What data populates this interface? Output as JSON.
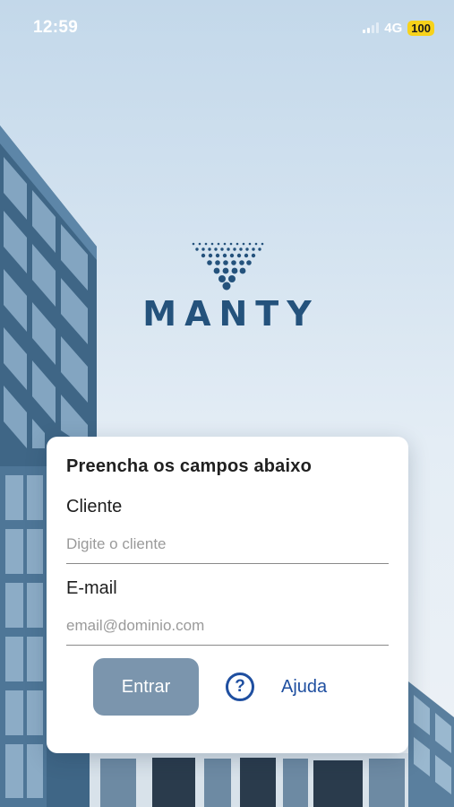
{
  "status_bar": {
    "time": "12:59",
    "network": "4G",
    "battery": "100"
  },
  "logo": {
    "brand": "MANTY",
    "mark_icon": "droplet-dots-icon"
  },
  "login_card": {
    "title": "Preencha os campos abaixo",
    "client": {
      "label": "Cliente",
      "placeholder": "Digite o cliente",
      "value": ""
    },
    "email": {
      "label": "E-mail",
      "placeholder": "email@dominio.com",
      "value": ""
    },
    "enter_label": "Entrar",
    "help_label": "Ajuda",
    "help_icon": "question-circle-icon"
  },
  "colors": {
    "brand": "#24527c",
    "button_bg": "#7b95ad",
    "link": "#1f4fa0",
    "battery": "#f7d21a"
  }
}
